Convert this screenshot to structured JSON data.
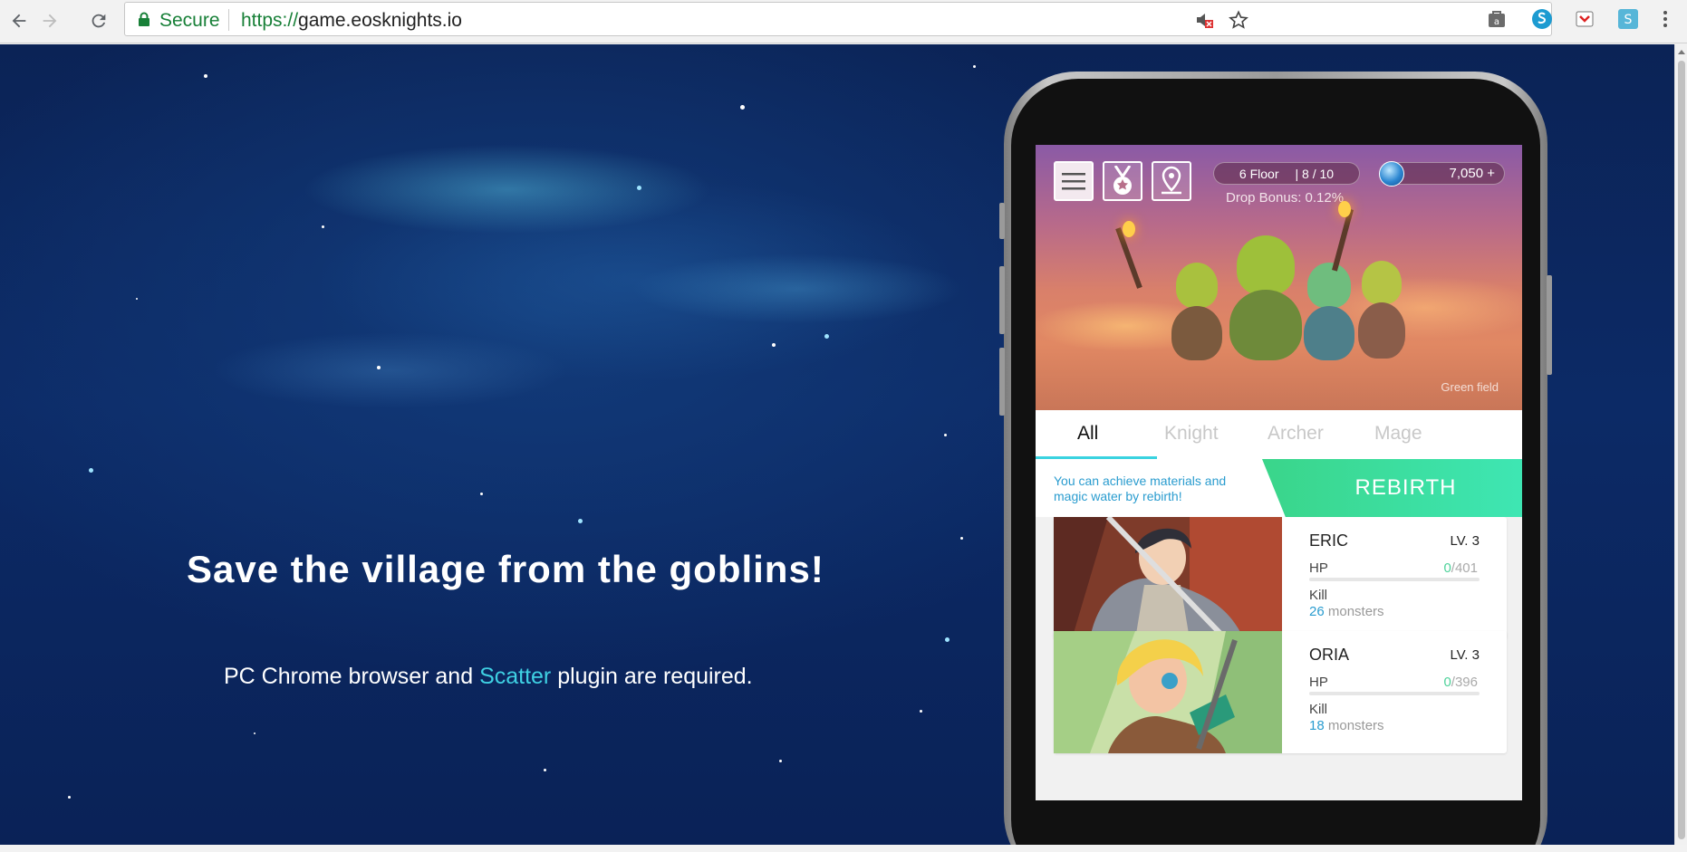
{
  "browser": {
    "secure_label": "Secure",
    "url_protocol": "https://",
    "url_host": "game.eosknights.io"
  },
  "page": {
    "headline": "Save the village from the goblins!",
    "requirement_prefix": "PC Chrome browser and ",
    "requirement_link": "Scatter",
    "requirement_suffix": " plugin are required."
  },
  "game": {
    "floor_label": "6 Floor",
    "floor_progress": "| 8 / 10",
    "drop_bonus": "Drop Bonus: 0.12%",
    "magic_water": "7,050 +",
    "field_name": "Green field",
    "tabs": [
      {
        "label": "All"
      },
      {
        "label": "Knight"
      },
      {
        "label": "Archer"
      },
      {
        "label": "Mage"
      }
    ],
    "rebirth_info": "You can achieve materials and magic water by rebirth!",
    "rebirth_label": "REBIRTH",
    "heroes": [
      {
        "name": "ERIC",
        "level": "LV. 3",
        "hp_label": "HP",
        "hp_current": "0",
        "hp_max": "/401",
        "kill_label": "Kill",
        "kills": "26",
        "kill_unit": " monsters"
      },
      {
        "name": "ORIA",
        "level": "LV. 3",
        "hp_label": "HP",
        "hp_current": "0",
        "hp_max": "/396",
        "kill_label": "Kill",
        "kills": "18",
        "kill_unit": " monsters"
      }
    ]
  },
  "colors": {
    "secure_green": "#188038",
    "link_cyan": "#3fd0e3",
    "rebirth_green": "#3ad58a",
    "tab_accent": "#3ad3e0"
  },
  "icons": [
    "back-arrow-icon",
    "forward-arrow-icon",
    "reload-icon",
    "lock-icon",
    "muted-sound-icon",
    "star-icon",
    "menu-icon",
    "medal-icon",
    "map-pin-icon",
    "magic-orb-icon"
  ]
}
